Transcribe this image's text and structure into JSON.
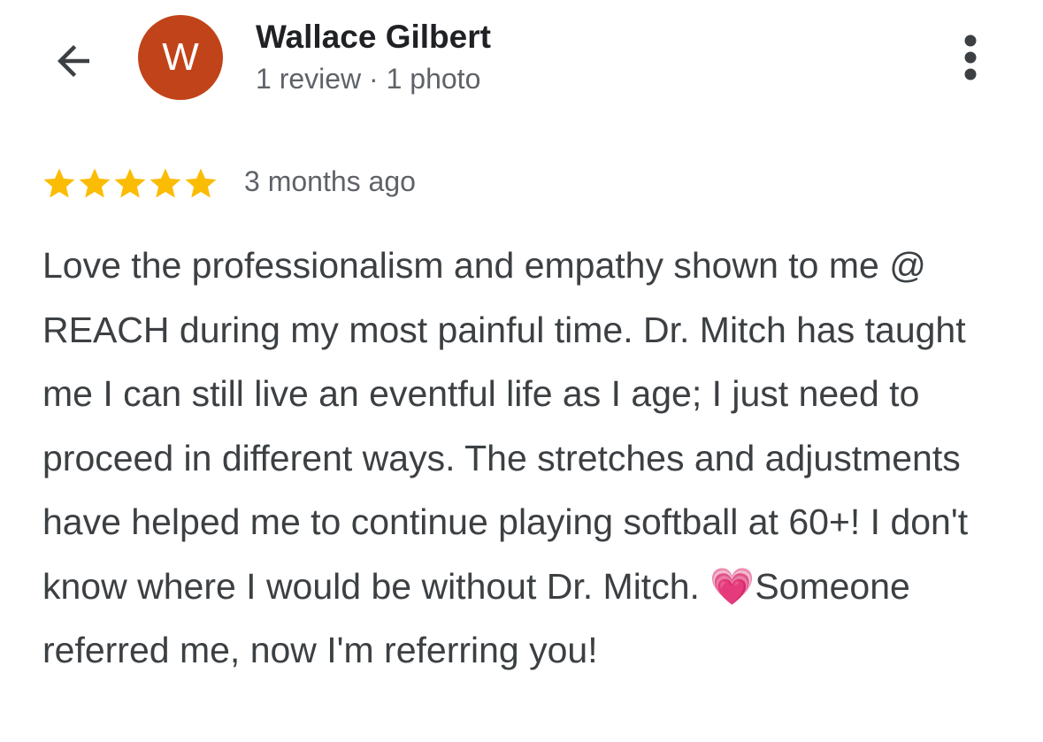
{
  "reviewer": {
    "initial": "W",
    "name": "Wallace Gilbert",
    "meta": "1 review · 1 photo",
    "avatar_color": "#c1431a"
  },
  "icons": {
    "back": "arrow-left-icon",
    "more": "more-vertical-icon",
    "star": "star-icon"
  },
  "review": {
    "rating": 5,
    "max_rating": 5,
    "star_color": "#fbbc04",
    "date": "3 months ago",
    "text": "Love the professionalism and empathy shown to me @ REACH during my most painful time. Dr. Mitch has taught me I can still live an eventful life as I age; I just need to proceed in different ways. The stretches and adjustments have helped me to continue playing softball at 60+! I don't know where I would be without Dr. Mitch. 💗Someone referred me, now I'm referring you!"
  }
}
